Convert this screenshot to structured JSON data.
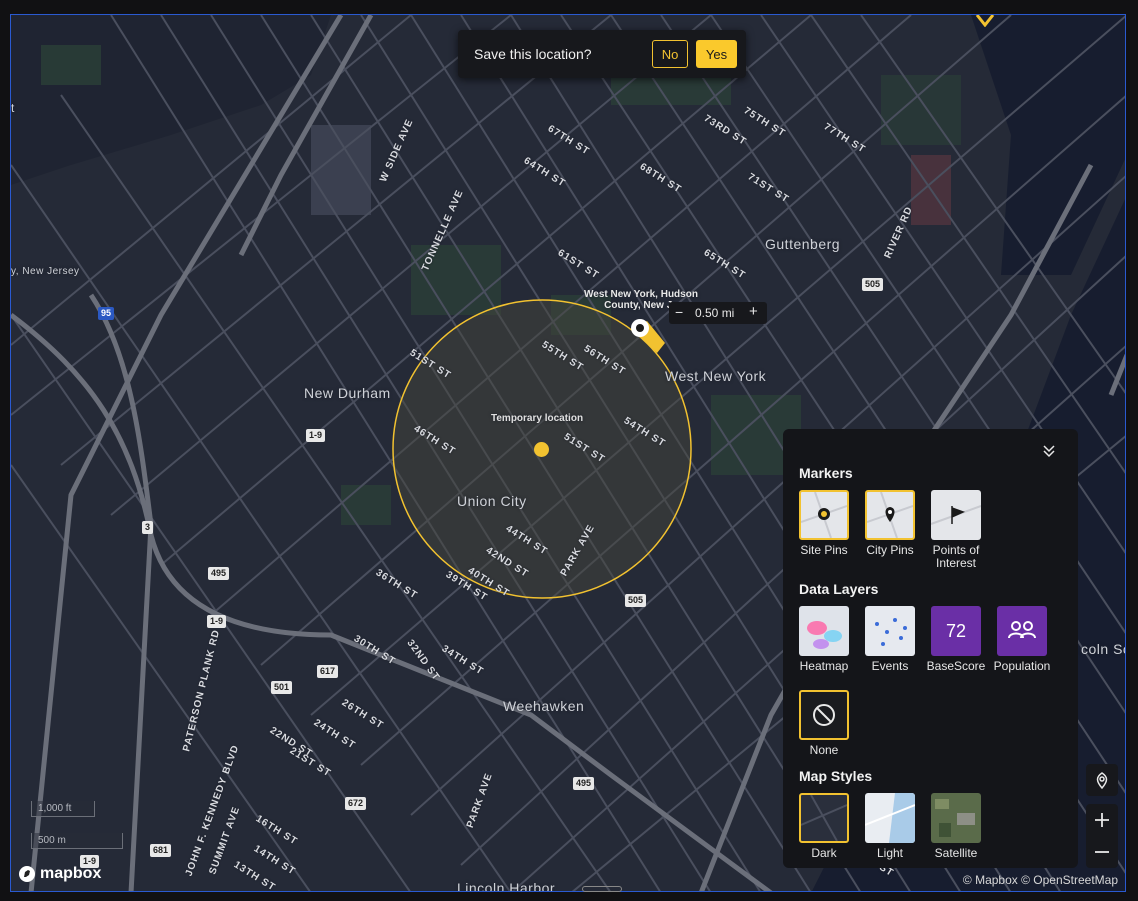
{
  "prompt": {
    "question": "Save this location?",
    "no_label": "No",
    "yes_label": "Yes"
  },
  "map": {
    "marker_label": "West New York, Hudson County, New Je",
    "radius_value": "0.50 mi",
    "temp_label": "Temporary location",
    "places": [
      "Guttenberg",
      "West New York",
      "New Durham",
      "Union City",
      "Weehawken",
      "Lincoln Harbor",
      "y, New Jersey",
      "coln So",
      "t"
    ],
    "streets": [
      "W SIDE AVE",
      "TONNELLE AVE",
      "67TH ST",
      "64TH ST",
      "68TH ST",
      "73RD ST",
      "75TH ST",
      "77TH ST",
      "71ST ST",
      "RIVER RD",
      "61ST ST",
      "65TH ST",
      "51ST ST",
      "55TH ST",
      "56TH ST",
      "54TH ST",
      "46TH ST",
      "51ST ST",
      "44TH ST",
      "42ND ST",
      "40TH ST",
      "39TH ST",
      "36TH ST",
      "PARK AVE",
      "30TH ST",
      "32ND ST",
      "34TH ST",
      "PATERSON PLANK RD",
      "26TH ST",
      "24TH ST",
      "22ND ST",
      "21ST ST",
      "JOHN F. KENNEDY BLVD",
      "SUMMIT AVE",
      "16TH ST",
      "14TH ST",
      "13TH ST",
      "PARK AVE",
      "ST"
    ],
    "shields": [
      "95",
      "1-9",
      "3",
      "495",
      "1-9",
      "505",
      "505",
      "617",
      "501",
      "672",
      "681",
      "495",
      "1-9"
    ]
  },
  "scale": {
    "ft": "1,000 ft",
    "m": "500 m"
  },
  "attribution": {
    "mapbox": "© Mapbox",
    "osm": "© OpenStreetMap"
  },
  "logo": "mapbox",
  "panel": {
    "markers_title": "Markers",
    "markers": [
      {
        "label": "Site Pins",
        "icon": "site-pin-icon",
        "selected": true
      },
      {
        "label": "City Pins",
        "icon": "city-pin-icon",
        "selected": true
      },
      {
        "label": "Points of Interest",
        "icon": "flag-icon",
        "selected": false
      }
    ],
    "layers_title": "Data Layers",
    "layers": [
      {
        "label": "Heatmap",
        "selected": false
      },
      {
        "label": "Events",
        "selected": false
      },
      {
        "label": "BaseScore",
        "value": "72",
        "selected": false
      },
      {
        "label": "Population",
        "icon": "population-icon",
        "selected": false
      },
      {
        "label": "None",
        "icon": "none-icon",
        "selected": true
      }
    ],
    "styles_title": "Map Styles",
    "styles": [
      {
        "label": "Dark",
        "selected": true
      },
      {
        "label": "Light",
        "selected": false
      },
      {
        "label": "Satellite",
        "selected": false
      }
    ]
  },
  "colors": {
    "accent": "#fac92c",
    "map_bg": "#252a37",
    "water": "#161c2e",
    "panel": "#141519"
  }
}
